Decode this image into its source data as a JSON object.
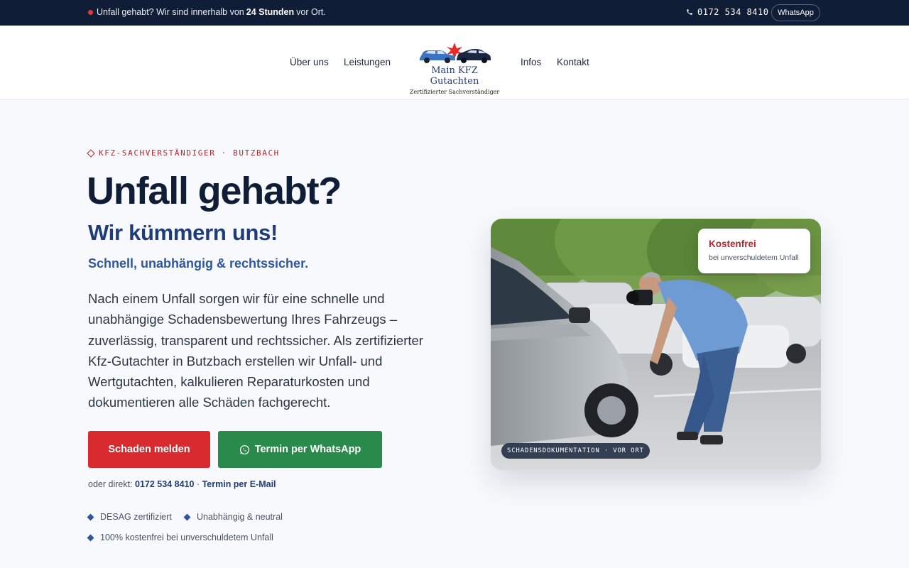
{
  "topbar": {
    "notice_pre": "Unfall gehabt? Wir sind innerhalb von",
    "notice_bold": "24 Stunden",
    "notice_post": "vor Ort.",
    "phone": "0172 534 8410",
    "whatsapp_label": "WhatsApp"
  },
  "nav": {
    "items": [
      {
        "label": "Über uns"
      },
      {
        "label": "Leistungen"
      },
      {
        "label": "Infos"
      },
      {
        "label": "Kontakt"
      }
    ],
    "logo_brand": "Main KFZ Gutachten",
    "logo_tagline": "Zertifizierter Sachverständiger"
  },
  "hero": {
    "eyebrow": "KFZ-SACHVERSTÄNDIGER · BUTZBACH",
    "title": "Unfall gehabt?",
    "subtitle": "Wir kümmern uns!",
    "tagline": "Schnell, unabhängig & rechtssicher.",
    "lead": "Nach einem Unfall sorgen wir für eine schnelle und unabhängige Schadensbewertung Ihres Fahrzeugs – zuverlässig, transparent und rechtssicher. Als zertifizierter Kfz-Gutachter in Butzbach erstellen wir Unfall- und Wertgutachten, kalkulieren Reparaturkosten und dokumentieren alle Schäden fachgerecht.",
    "btn_primary": "Schaden melden",
    "btn_whatsapp": "Termin per WhatsApp",
    "direct_prefix": "oder direkt:",
    "direct_phone": "0172 534 8410",
    "direct_sep": "·",
    "direct_email": "Termin per E-Mail",
    "features": [
      "DESAG zertifiziert",
      "Unabhängig & neutral",
      "100% kostenfrei bei unverschuldetem Unfall"
    ]
  },
  "photo": {
    "badge_title": "Kostenfrei",
    "badge_sub": "bei unverschuldetem Unfall",
    "caption": "SCHADENSDOKUMENTATION · VOR ORT"
  },
  "colors": {
    "topbar_bg": "#101d36",
    "accent_red": "#d92b2f",
    "accent_green": "#2a8a4b",
    "navy": "#1f3c7a"
  }
}
